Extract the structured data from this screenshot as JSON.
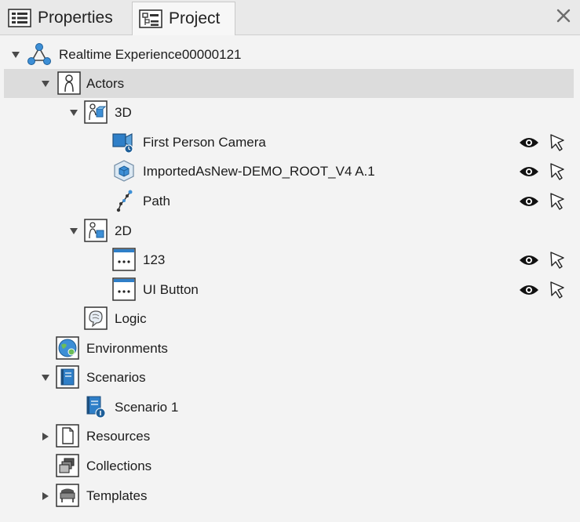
{
  "tabs": [
    {
      "label": "Properties",
      "icon": "properties-icon",
      "active": false
    },
    {
      "label": "Project",
      "icon": "project-icon",
      "active": true
    }
  ],
  "close_icon": "close-icon",
  "tree": {
    "root": {
      "label": "Realtime Experience00000121",
      "icon": "network-icon",
      "expanded": true
    },
    "actors": {
      "label": "Actors",
      "icon": "actor-icon",
      "expanded": true,
      "selected": true
    },
    "group_3d": {
      "label": "3D",
      "icon": "3d-group-icon",
      "expanded": true
    },
    "camera": {
      "label": "First Person Camera",
      "icon": "camera-icon"
    },
    "imported": {
      "label": "ImportedAsNew-DEMO_ROOT_V4 A.1",
      "icon": "cube-icon"
    },
    "path": {
      "label": "Path",
      "icon": "path-icon"
    },
    "group_2d": {
      "label": "2D",
      "icon": "2d-group-icon",
      "expanded": true
    },
    "item_123": {
      "label": "123",
      "icon": "ui-widget-icon"
    },
    "ui_button": {
      "label": "UI Button",
      "icon": "ui-widget-icon"
    },
    "logic": {
      "label": "Logic",
      "icon": "logic-icon"
    },
    "environments": {
      "label": "Environments",
      "icon": "environment-icon"
    },
    "scenarios": {
      "label": "Scenarios",
      "icon": "scenarios-icon",
      "expanded": true
    },
    "scenario1": {
      "label": "Scenario 1",
      "icon": "scenario-icon"
    },
    "resources": {
      "label": "Resources",
      "icon": "document-icon",
      "expanded": false
    },
    "collections": {
      "label": "Collections",
      "icon": "collection-icon"
    },
    "templates": {
      "label": "Templates",
      "icon": "template-icon",
      "expanded": false
    }
  },
  "row_actions": {
    "visibility_icon": "eye-icon",
    "selectable_icon": "cursor-icon"
  },
  "colors": {
    "selected_row": "#dcdcdc",
    "background": "#f3f3f3",
    "tab_bar": "#e9e9e9"
  }
}
